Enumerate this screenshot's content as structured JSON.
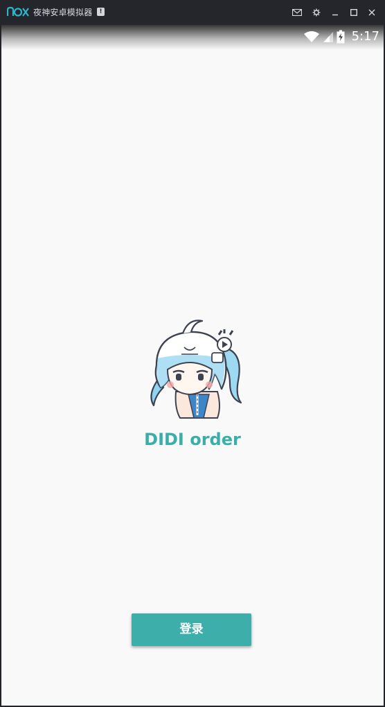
{
  "window": {
    "title": "夜神安卓模拟器",
    "badge": "!",
    "logo_text": "nox",
    "controls": [
      "mail-icon",
      "settings-gear-icon",
      "minimize-icon",
      "maximize-icon",
      "close-icon"
    ]
  },
  "status_bar": {
    "time": "5:17",
    "icons": [
      "wifi-icon",
      "cell-signal-icon",
      "battery-charging-icon"
    ]
  },
  "app": {
    "name": "DIDI order",
    "login_label": "登录",
    "mascot": "mascot-girl-image"
  },
  "colors": {
    "accent": "#3daea9",
    "screen_background": "#f9f9f9",
    "titlebar": "#24262b"
  }
}
